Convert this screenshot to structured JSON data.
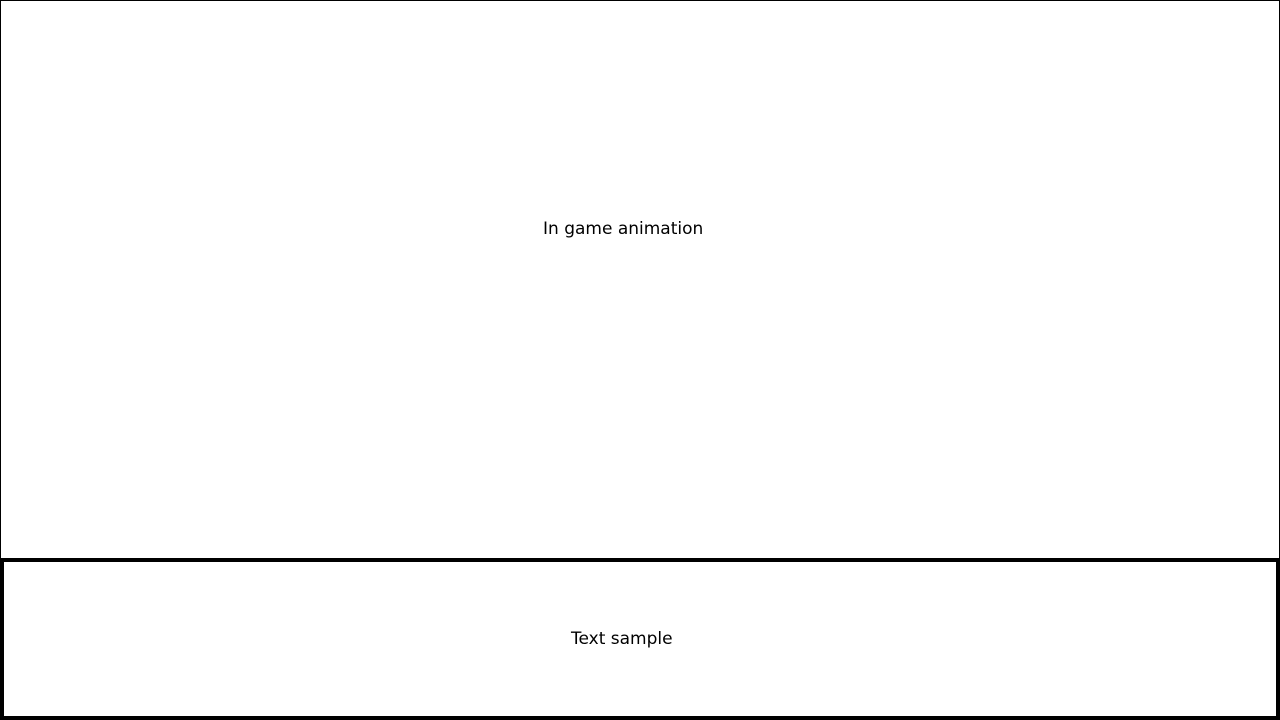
{
  "game_view": {
    "label": "In game animation"
  },
  "dialog_box": {
    "text": "Text sample"
  }
}
